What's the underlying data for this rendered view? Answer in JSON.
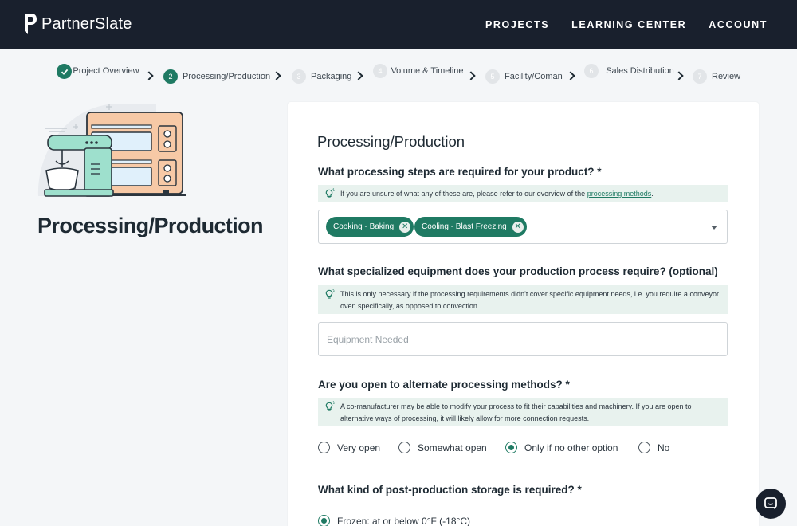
{
  "brand": {
    "name": "PartnerSlate"
  },
  "nav": {
    "projects": "PROJECTS",
    "learning": "LEARNING CENTER",
    "account": "ACCOUNT"
  },
  "steps": [
    {
      "num": "",
      "label": "Project Overview",
      "status": "done"
    },
    {
      "num": "2",
      "label": "Processing/Production",
      "status": "current"
    },
    {
      "num": "3",
      "label": "Packaging",
      "status": "upcoming"
    },
    {
      "num": "4",
      "label": "Volume & Timeline",
      "status": "upcoming"
    },
    {
      "num": "5",
      "label": "Facility/Coman",
      "status": "upcoming"
    },
    {
      "num": "6",
      "label": "Sales Distribution",
      "status": "upcoming"
    },
    {
      "num": "7",
      "label": "Review",
      "status": "upcoming"
    }
  ],
  "sidebar": {
    "title": "Processing/Production"
  },
  "form": {
    "title": "Processing/Production",
    "q1": {
      "label": "What processing steps are required for your product? *",
      "hint": "If you are unsure of what any of these are, please refer to our overview of the",
      "hint_link": "processing methods",
      "hint_end": ".",
      "chips": [
        "Cooking - Baking",
        "Cooling - Blast Freezing"
      ]
    },
    "q2": {
      "label": "What specialized equipment does your production process require? (optional)",
      "hint": "This is only necessary if the processing requirements didn't cover specific equipment needs, i.e. you require a conveyor oven specifically, as opposed to convection.",
      "placeholder": "Equipment Needed"
    },
    "q3": {
      "label": "Are you open to alternate processing methods? *",
      "hint": "A co-manufacturer may be able to modify your process to fit their capabilities and machinery. If you are open to alternative ways of processing, it will likely allow for more connection requests.",
      "options": [
        "Very open",
        "Somewhat open",
        "Only if no other option",
        "No"
      ],
      "selected": "Only if no other option"
    },
    "q4": {
      "label": "What kind of post-production storage is required? *",
      "options": [
        "Frozen: at or below 0°F (-18°C)"
      ],
      "selected": "Frozen: at or below 0°F (-18°C)"
    }
  },
  "colors": {
    "header": "#19202d",
    "accent": "#1f7a63",
    "hint_bg": "#e8f2ee",
    "page_bg": "#f4f6f8"
  },
  "icons": {
    "chat": "chat-bubble-icon",
    "hint": "lightbulb-icon",
    "done": "check-icon"
  }
}
